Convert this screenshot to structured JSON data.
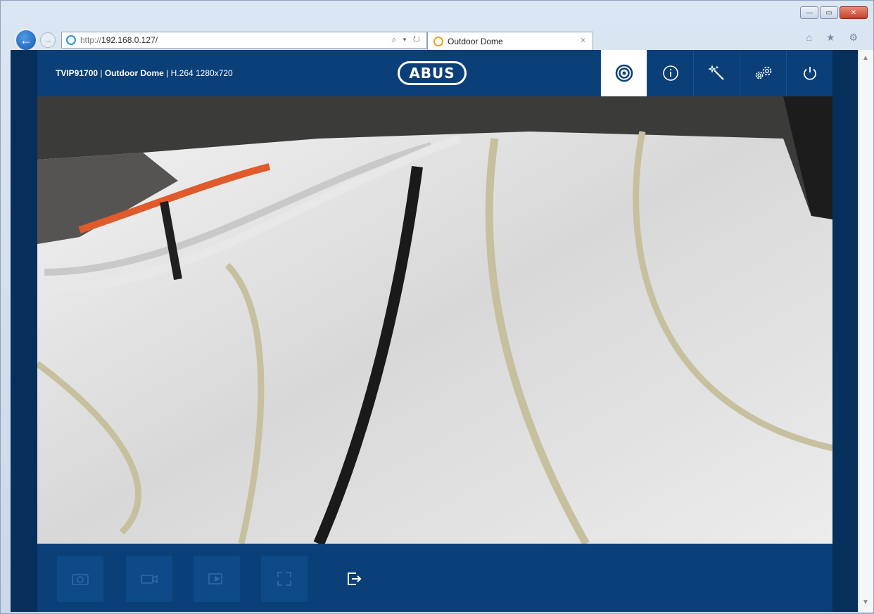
{
  "browser": {
    "url_protocol": "http://",
    "url_host": "192.168.0.127/",
    "address_tools": "⌕ ▾ ↻",
    "tab_title": "Outdoor Dome",
    "tab_close": "×",
    "window_minimize": "—",
    "window_maximize": "▭",
    "window_close": "✕",
    "back_glyph": "←",
    "forward_glyph": "→",
    "right_icons": "⌂ ★ ⚙"
  },
  "app": {
    "model": "TVIP91700",
    "separator1": " | ",
    "camera_name": "Outdoor Dome",
    "separator2": " | ",
    "stream": "H.264 1280x720",
    "logo": "ABUS"
  },
  "toolbar": {
    "items": [
      {
        "name": "live-view-icon",
        "active": true
      },
      {
        "name": "info-icon",
        "active": false
      },
      {
        "name": "wizard-icon",
        "active": false
      },
      {
        "name": "settings-icon",
        "active": false
      },
      {
        "name": "power-icon",
        "active": false
      }
    ]
  },
  "controls": {
    "items": [
      {
        "name": "snapshot-icon",
        "active": false
      },
      {
        "name": "record-icon",
        "active": false
      },
      {
        "name": "playback-icon",
        "active": false
      },
      {
        "name": "fullscreen-icon",
        "active": false
      },
      {
        "name": "logout-icon",
        "active": true
      }
    ]
  },
  "colors": {
    "header": "#0a3f78",
    "side": "#062f5c",
    "active_tool": "#ffffff"
  }
}
